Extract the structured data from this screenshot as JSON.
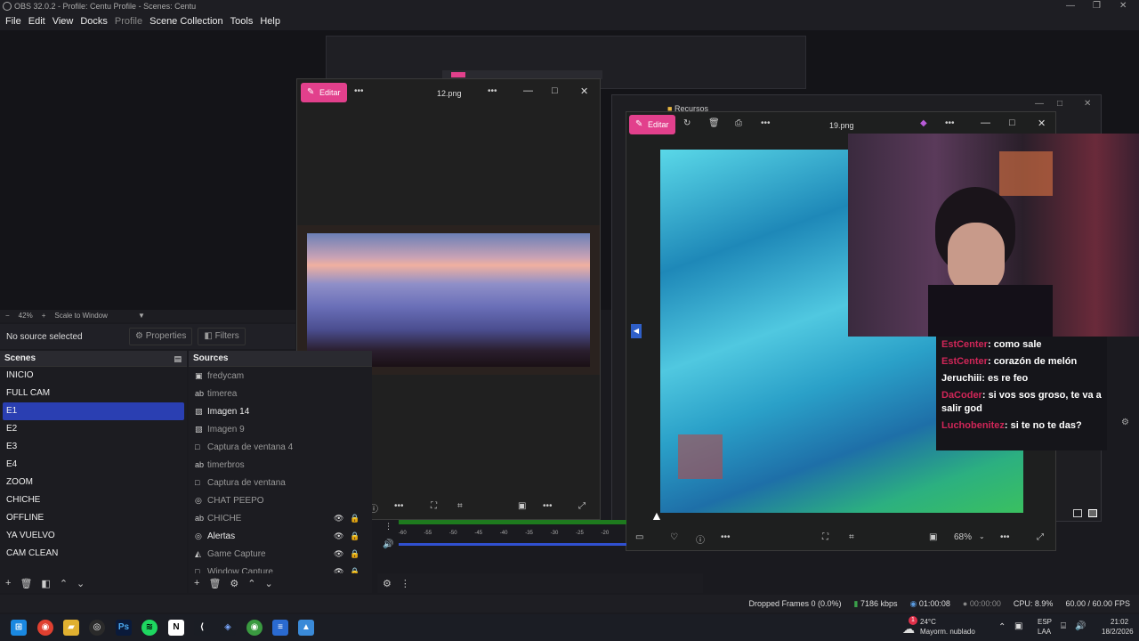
{
  "obs": {
    "title": "OBS 32.0.2 - Profile: Centu Profile - Scenes: Centu",
    "menu": [
      "File",
      "Edit",
      "View",
      "Docks",
      "Profile",
      "Scene Collection",
      "Tools",
      "Help"
    ],
    "zoom": "42%",
    "zoom_mode": "Scale to Window",
    "no_source": "No source selected",
    "properties_label": "Properties",
    "filters_label": "Filters",
    "scenes_title": "Scenes",
    "sources_title": "Sources",
    "scenes": [
      "INICIO",
      "FULL CAM",
      "E1",
      "E2",
      "E3",
      "E4",
      "ZOOM",
      "CHICHE",
      "OFFLINE",
      "YA VUELVO",
      "CAM CLEAN"
    ],
    "selected_scene": "E1",
    "sources": [
      {
        "name": "fredycam",
        "icon": "camera-icon",
        "glyph": "▣"
      },
      {
        "name": "timerea",
        "icon": "text-icon",
        "glyph": "ab"
      },
      {
        "name": "Imagen 14",
        "icon": "image-icon",
        "glyph": "▧"
      },
      {
        "name": "Imagen 9",
        "icon": "image-icon",
        "glyph": "▧"
      },
      {
        "name": "Captura de ventana 4",
        "icon": "window-icon",
        "glyph": "□"
      },
      {
        "name": "timerbros",
        "icon": "text-icon",
        "glyph": "ab"
      },
      {
        "name": "Captura de ventana",
        "icon": "window-icon",
        "glyph": "□"
      },
      {
        "name": "CHAT PEEPO",
        "icon": "browser-icon",
        "glyph": "◎"
      },
      {
        "name": "CHICHE",
        "icon": "text-icon",
        "glyph": "ab"
      },
      {
        "name": "Alertas",
        "icon": "browser-icon",
        "glyph": "◎"
      },
      {
        "name": "Game Capture",
        "icon": "gamepad-icon",
        "glyph": "◭"
      },
      {
        "name": "Window Capture",
        "icon": "window-icon",
        "glyph": "□"
      }
    ],
    "status": {
      "dropped": "Dropped Frames 0 (0.0%)",
      "kbps": "7186 kbps",
      "stream_time": "01:00:08",
      "rec_time": "00:00:00",
      "cpu": "CPU: 8.9%",
      "fps": "60.00 / 60.00 FPS"
    },
    "mixer_ticks": [
      "-60",
      "-55",
      "-50",
      "-45",
      "-40",
      "-35",
      "-30",
      "-25",
      "-20"
    ]
  },
  "photo1": {
    "edit_label": "Editar",
    "filename": "12.png"
  },
  "photo2": {
    "edit_label": "Editar",
    "filename": "19.png",
    "zoom": "68%"
  },
  "bg_window": {
    "tab_label": "Recursos"
  },
  "chat": [
    {
      "user": "EstCenter",
      "msg": ": como sale"
    },
    {
      "user": "EstCenter",
      "msg": ": corazón de melón"
    },
    {
      "user": "Jeruchiii",
      "msg": ": es re feo",
      "white": true
    },
    {
      "user": "DaCoder",
      "msg": ": si vos sos groso, te va a salir god"
    },
    {
      "user": "Luchobenitez",
      "msg": ": si te no te das?"
    }
  ],
  "taskbar": {
    "weather_temp": "24°C",
    "weather_desc": "Mayorm. nublado",
    "lang1": "ESP",
    "lang2": "LAA",
    "time": "21:02",
    "date": "18/2/2026",
    "badge": "1"
  }
}
